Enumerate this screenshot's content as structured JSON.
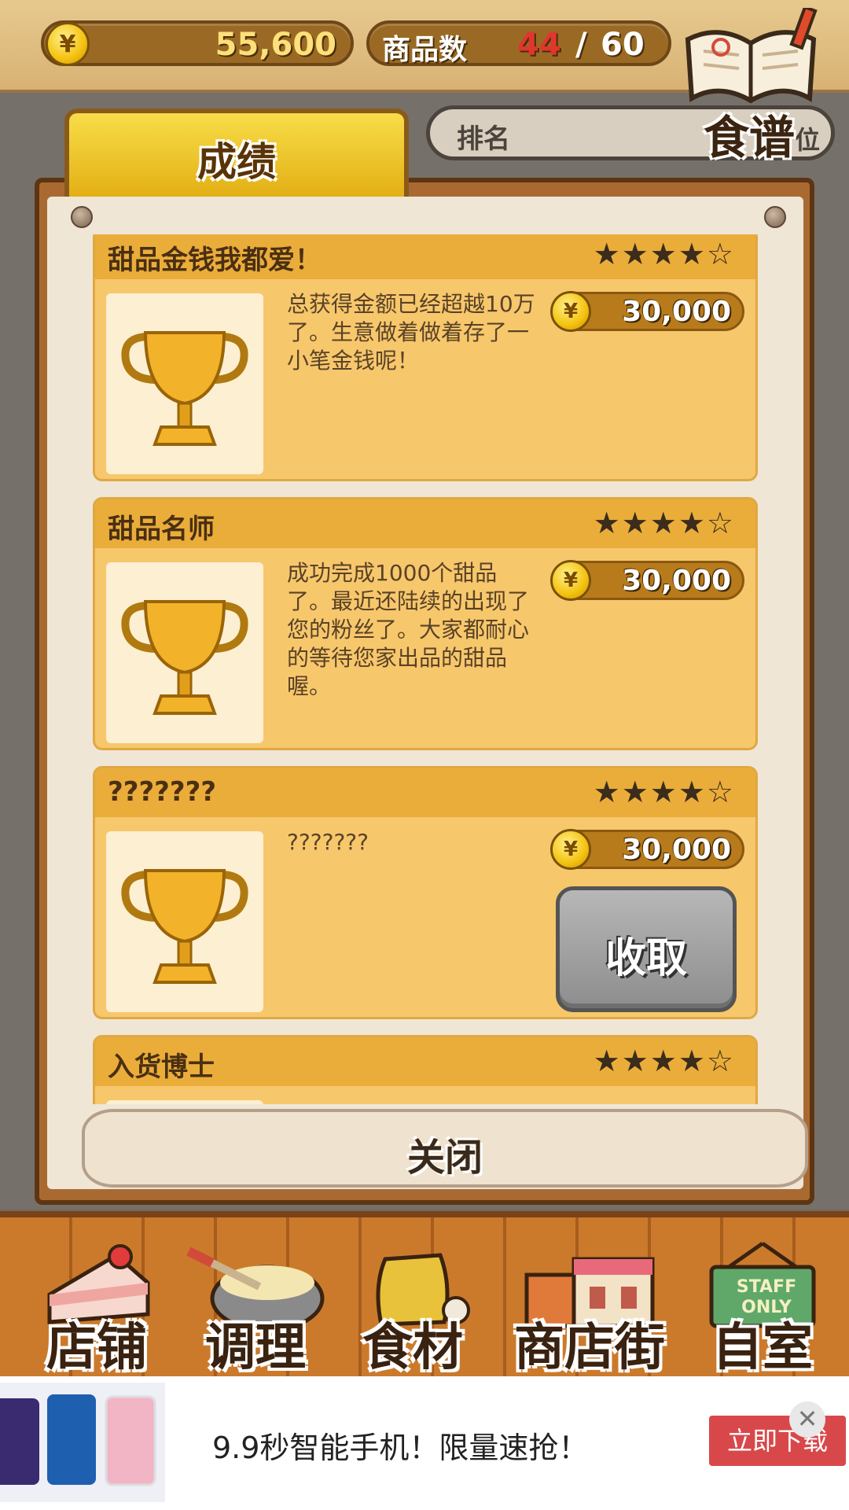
{
  "header": {
    "coin_symbol": "¥",
    "coins": "55,600",
    "item_count_label": "商品数",
    "item_count_current": "44",
    "item_count_separator": "/",
    "item_count_max": "60",
    "recipe_label": "食谱"
  },
  "ranking": {
    "label": "排名",
    "suffix": "位"
  },
  "panel": {
    "tab_label": "成绩",
    "close_label": "关闭",
    "achievements": [
      {
        "title": "甜品金钱我都爱！",
        "stars": "★★★★☆",
        "description": "总获得金额已经超越10万了。生意做着做着存了一小笔金钱呢！",
        "reward": "30,000"
      },
      {
        "title": "甜品名师",
        "stars": "★★★★☆",
        "description": "成功完成1000个甜品了。最近还陆续的出现了您的粉丝了。大家都耐心的等待您家出品的甜品喔。",
        "reward": "30,000"
      },
      {
        "title": "???????",
        "stars": "★★★★☆",
        "description": "???????",
        "reward": "30,000",
        "button": "收取"
      },
      {
        "title": "入货博士",
        "stars": "★★★★☆"
      }
    ]
  },
  "nav": {
    "items": [
      {
        "label": "店铺",
        "icon": "cake-icon"
      },
      {
        "label": "调理",
        "icon": "mixing-bowl-icon"
      },
      {
        "label": "食材",
        "icon": "flour-sack-icon"
      },
      {
        "label": "商店街",
        "icon": "shop-icon"
      },
      {
        "label": "自室",
        "icon": "staff-only-sign-icon"
      }
    ],
    "staff_sign": "STAFF ONLY"
  },
  "ad": {
    "text": "9.9秒智能手机！限量速抢！",
    "cta": "立即下载",
    "close": "✕"
  },
  "colors": {
    "accent": "#eaad3a",
    "wood": "#a96a32",
    "coin": "#f4c20f",
    "count_red": "#e0362d",
    "ad_button": "#d8484b"
  }
}
